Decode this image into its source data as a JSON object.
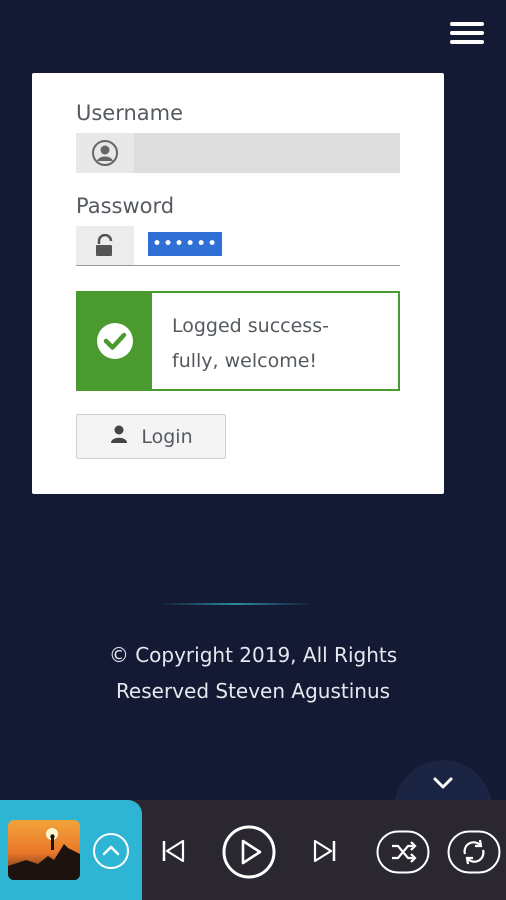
{
  "menu": {
    "icon": "hamburger-menu-icon"
  },
  "login": {
    "username_label": "Username",
    "username_value": "",
    "password_label": "Password",
    "password_value": "••••••",
    "alert_line1": "Logged success-",
    "alert_line2": "fully, welcome!",
    "alert_color": "#4a9a2f",
    "login_button": "Login"
  },
  "footer": {
    "line1": "© Copyright 2019, All Rights",
    "line2": "Reserved Steven Agustinus"
  },
  "player": {
    "accent": "#2db5d3",
    "controls": [
      "expand-up-icon",
      "previous-icon",
      "play-icon",
      "next-icon",
      "shuffle-icon",
      "repeat-icon"
    ]
  }
}
